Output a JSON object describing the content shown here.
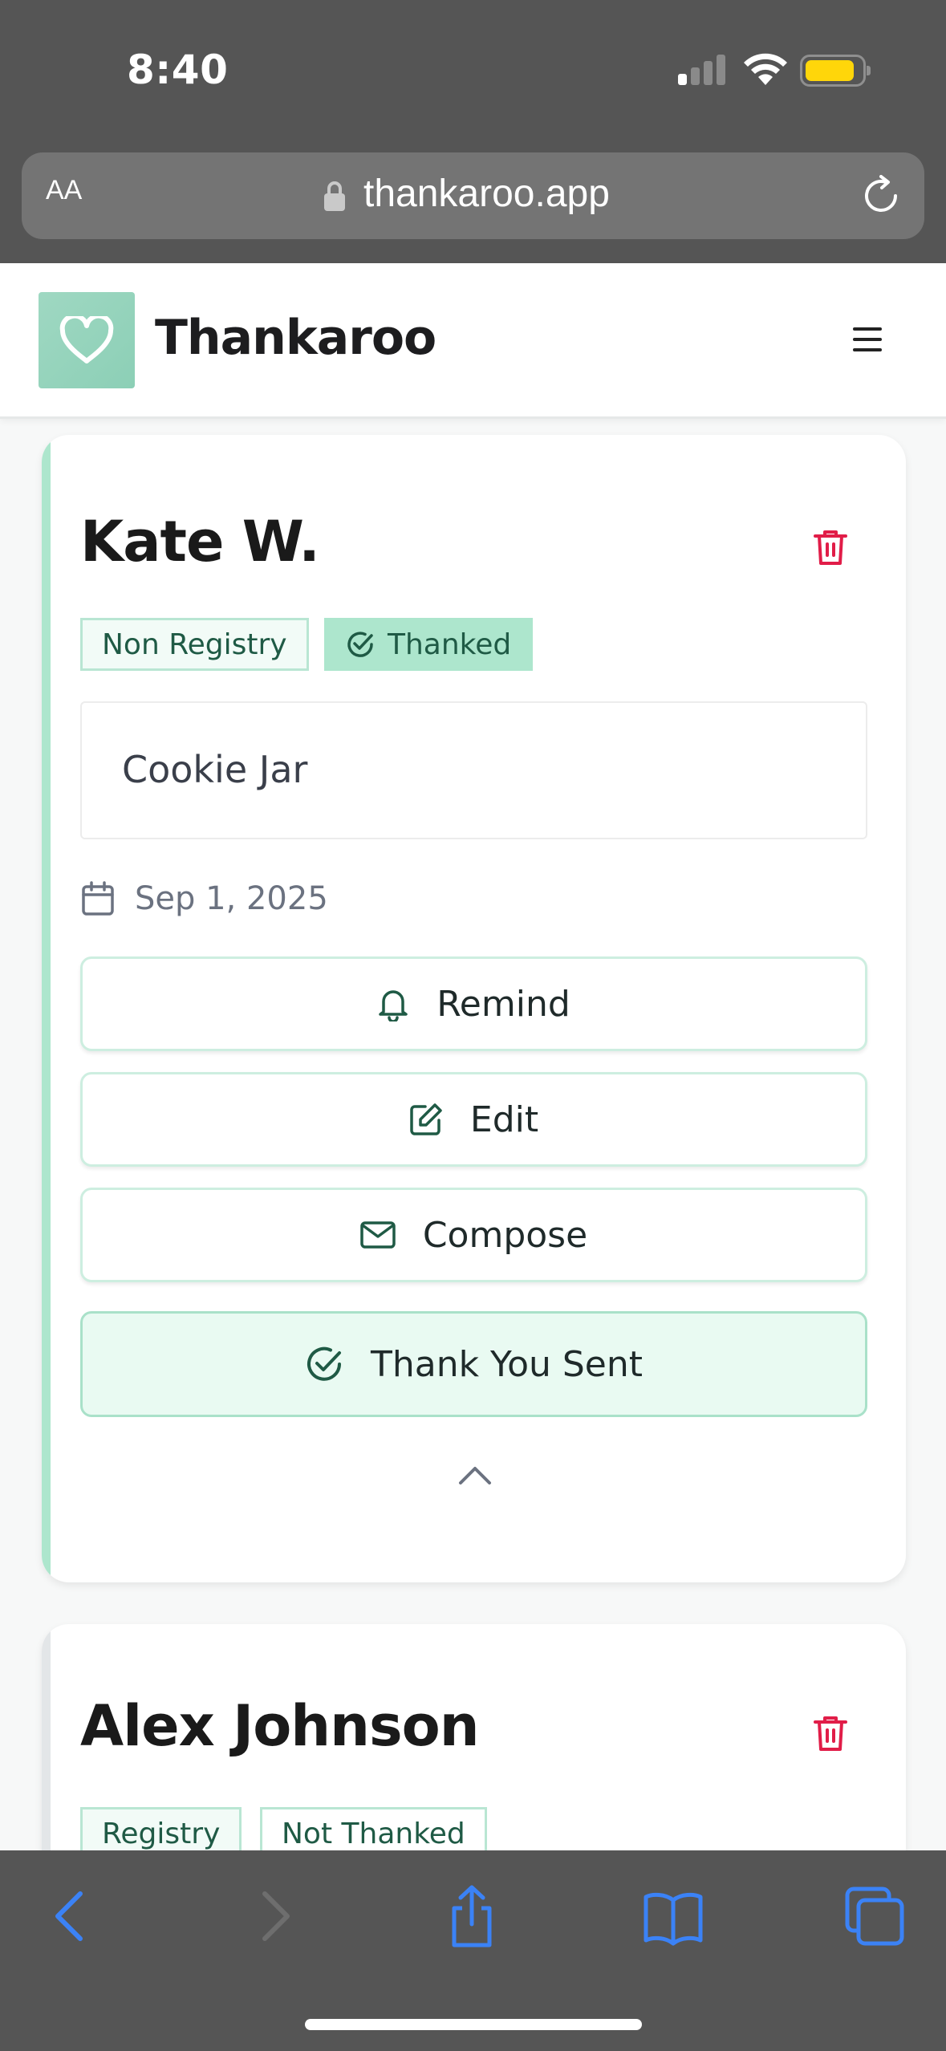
{
  "status_bar": {
    "time": "8:40"
  },
  "browser": {
    "text_size_label": "AA",
    "url": "thankaroo.app"
  },
  "app": {
    "brand": "Thankaroo"
  },
  "colors": {
    "accent": "#ade6cd",
    "danger": "#e11d48",
    "ios_blue": "#3b82f6"
  },
  "cards": [
    {
      "name": "Kate W.",
      "badges": [
        "Non Registry",
        "Thanked"
      ],
      "item": "Cookie Jar",
      "date": "Sep 1, 2025",
      "actions": [
        "Remind",
        "Edit",
        "Compose"
      ],
      "primary_action": "Thank You Sent"
    },
    {
      "name": "Alex Johnson",
      "badges": [
        "Registry",
        "Not Thanked"
      ]
    }
  ]
}
